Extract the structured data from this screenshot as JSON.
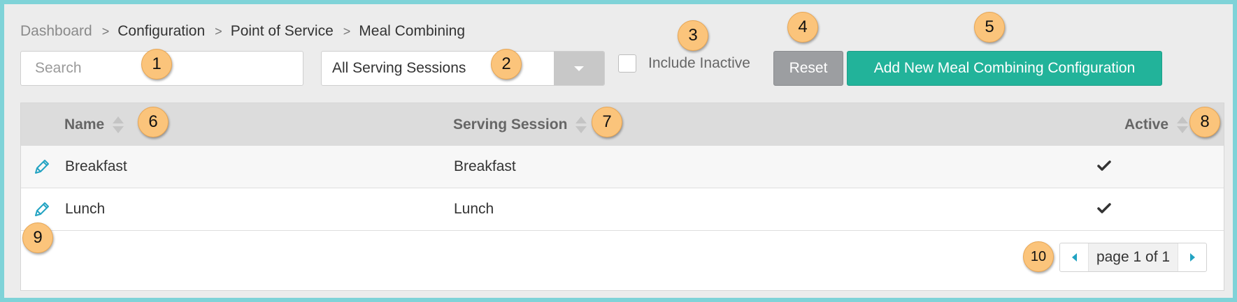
{
  "breadcrumb": {
    "items": [
      "Dashboard",
      "Configuration",
      "Point of Service",
      "Meal Combining"
    ],
    "separator": ">"
  },
  "search": {
    "placeholder": "Search",
    "value": ""
  },
  "session_filter": {
    "selected": "All Serving Sessions"
  },
  "include_inactive": {
    "label": "Include Inactive",
    "checked": false
  },
  "buttons": {
    "reset": "Reset",
    "add_new": "Add New Meal Combining Configuration"
  },
  "table": {
    "columns": [
      "Name",
      "Serving Session",
      "Active"
    ],
    "rows": [
      {
        "name": "Breakfast",
        "serving_session": "Breakfast",
        "active": true
      },
      {
        "name": "Lunch",
        "serving_session": "Lunch",
        "active": true
      }
    ]
  },
  "pagination": {
    "text": "page 1 of 1",
    "page": 1,
    "total_pages": 1
  },
  "callouts": [
    "1",
    "2",
    "3",
    "4",
    "5",
    "6",
    "7",
    "8",
    "9",
    "10"
  ],
  "colors": {
    "frame_border": "#7fd3d8",
    "primary_button": "#22b39a",
    "reset_button": "#9c9ea1",
    "callout_fill": "#fbc47b",
    "icon_accent": "#22a3c2"
  },
  "icons": {
    "edit": "pencil-icon",
    "active": "checkmark-icon",
    "sort": "sort-icon",
    "dropdown": "chevron-down-icon",
    "prev": "chevron-left-icon",
    "next": "chevron-right-icon"
  }
}
